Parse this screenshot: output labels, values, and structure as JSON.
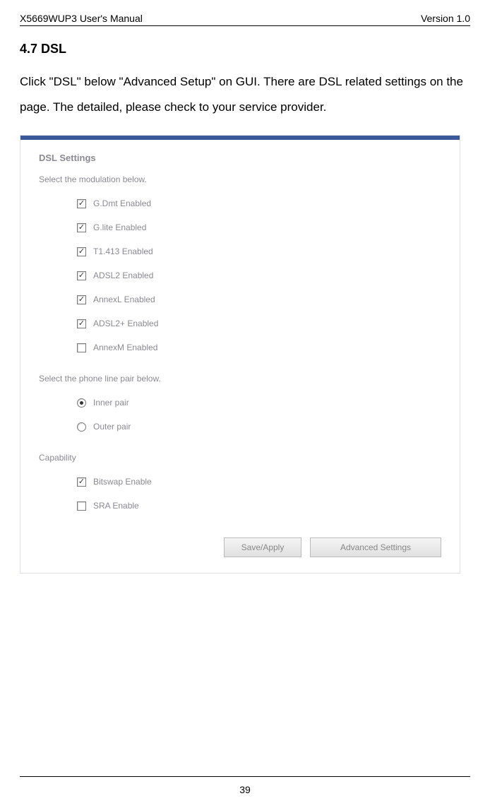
{
  "header": {
    "left": "X5669WUP3 User's Manual",
    "right": "Version 1.0"
  },
  "section": {
    "title": "4.7 DSL",
    "body1": "Click \"DSL\" below \"Advanced Setup\" on GUI. There are DSL related settings on the page. The detailed, please check to your service provider."
  },
  "panel": {
    "heading": "DSL Settings",
    "modulation_label": "Select the modulation below.",
    "modulation_options": [
      {
        "label": "G.Dmt Enabled",
        "checked": true
      },
      {
        "label": "G.lite Enabled",
        "checked": true
      },
      {
        "label": "T1.413 Enabled",
        "checked": true
      },
      {
        "label": "ADSL2 Enabled",
        "checked": true
      },
      {
        "label": "AnnexL Enabled",
        "checked": true
      },
      {
        "label": "ADSL2+ Enabled",
        "checked": true
      },
      {
        "label": "AnnexM Enabled",
        "checked": false
      }
    ],
    "phone_label": "Select the phone line pair below.",
    "phone_options": [
      {
        "label": "Inner pair",
        "selected": true
      },
      {
        "label": "Outer pair",
        "selected": false
      }
    ],
    "capability_label": "Capability",
    "capability_options": [
      {
        "label": "Bitswap Enable",
        "checked": true
      },
      {
        "label": "SRA Enable",
        "checked": false
      }
    ],
    "buttons": {
      "save": "Save/Apply",
      "advanced": "Advanced Settings"
    }
  },
  "footer": {
    "page": "39"
  }
}
